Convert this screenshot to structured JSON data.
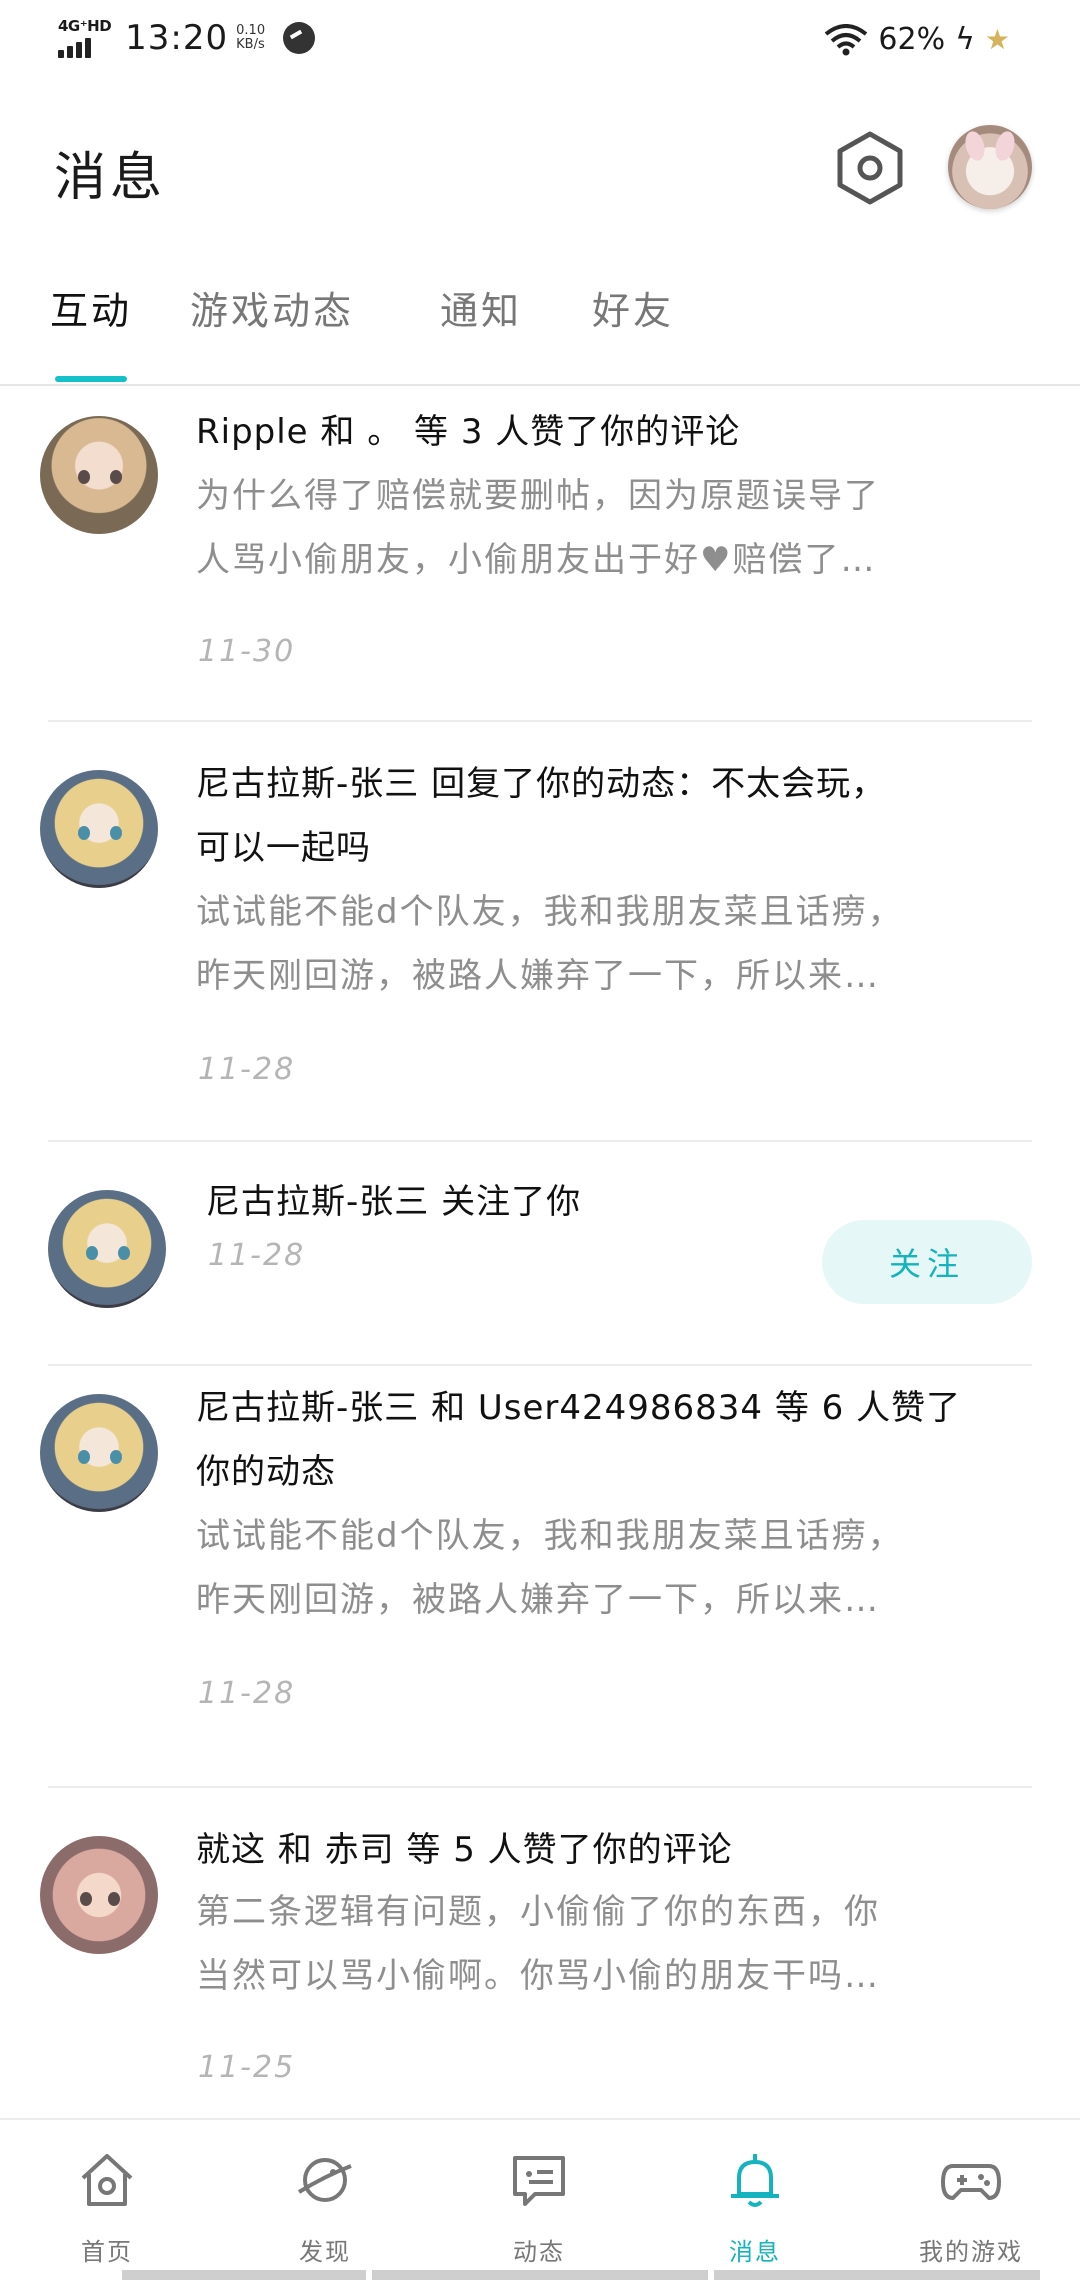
{
  "status_bar": {
    "network": "4G⁺HD",
    "time": "13:20",
    "speed_value": "0.10",
    "speed_unit": "KB/s",
    "battery": "62%"
  },
  "header": {
    "title": "消息",
    "settings_icon": "settings-hexagon-icon",
    "avatar_icon": "user-avatar"
  },
  "tabs": [
    {
      "label": "互动",
      "active": true
    },
    {
      "label": "游戏动态",
      "active": false
    },
    {
      "label": "通知",
      "active": false
    },
    {
      "label": "好友",
      "active": false
    }
  ],
  "items": [
    {
      "title": "Ripple 和 。 等 3 人赞了你的评论",
      "preview": [
        "为什么得了赔偿就要删帖，因为原题误导了",
        "人骂小偷朋友，小偷朋友出于好♥赔偿了…"
      ],
      "date": "11-30"
    },
    {
      "title": [
        "尼古拉斯-张三 回复了你的动态：不太会玩，",
        "可以一起吗"
      ],
      "preview": [
        "试试能不能d个队友，我和我朋友菜且话痨，",
        "昨天刚回游，被路人嫌弃了一下，所以来…"
      ],
      "date": "11-28"
    },
    {
      "title": "尼古拉斯-张三 关注了你",
      "date": "11-28",
      "button": "关注"
    },
    {
      "title": [
        "尼古拉斯-张三 和 User424986834 等 6 人赞了",
        "你的动态"
      ],
      "preview": [
        "试试能不能d个队友，我和我朋友菜且话痨，",
        "昨天刚回游，被路人嫌弃了一下，所以来…"
      ],
      "date": "11-28"
    },
    {
      "title": "就这 和 赤司 等 5 人赞了你的评论",
      "preview": [
        "第二条逻辑有问题，小偷偷了你的东西，你",
        "当然可以骂小偷啊。你骂小偷的朋友干吗…"
      ],
      "date": "11-25"
    }
  ],
  "bottom_nav": [
    {
      "label": "首页",
      "icon": "home-icon",
      "active": false
    },
    {
      "label": "发现",
      "icon": "planet-icon",
      "active": false
    },
    {
      "label": "动态",
      "icon": "chat-bubble-icon",
      "active": false
    },
    {
      "label": "消息",
      "icon": "bell-icon",
      "active": true
    },
    {
      "label": "我的游戏",
      "icon": "gamepad-icon",
      "active": false
    }
  ],
  "colors": {
    "accent": "#14c1c9",
    "follow_bg": "#e6f7f8",
    "text_secondary": "#8e8e8e",
    "date": "#b5b5b5"
  }
}
